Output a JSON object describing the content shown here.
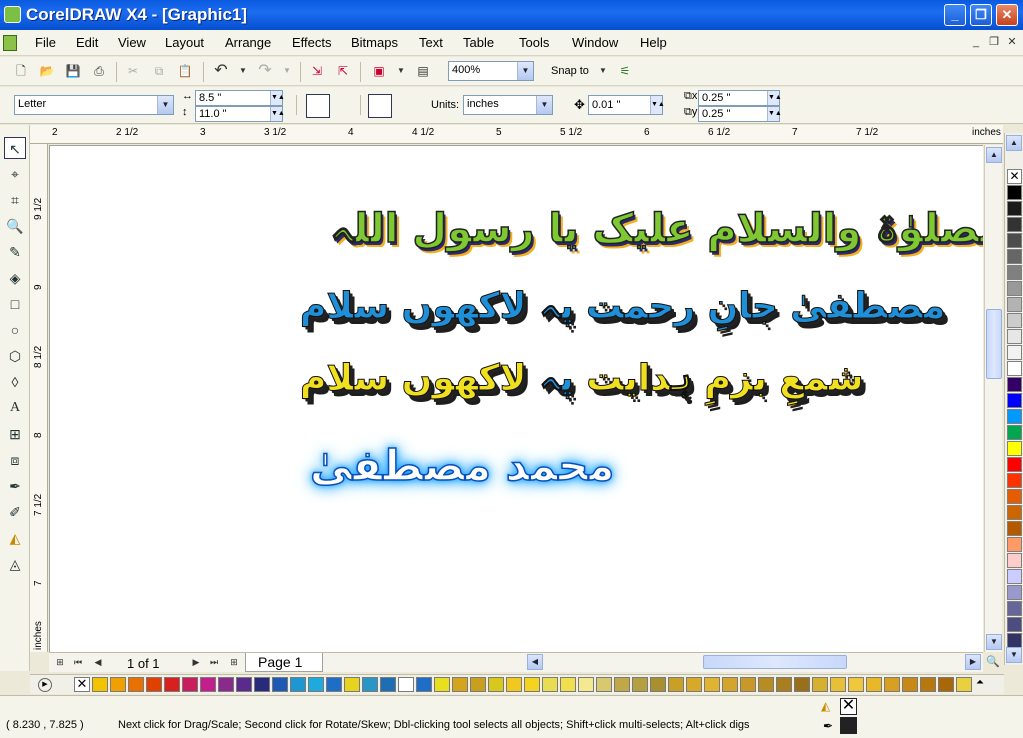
{
  "window": {
    "title": "CorelDRAW X4 - [Graphic1]"
  },
  "menu": [
    "File",
    "Edit",
    "View",
    "Layout",
    "Arrange",
    "Effects",
    "Bitmaps",
    "Text",
    "Table",
    "Tools",
    "Window",
    "Help"
  ],
  "toolbar": {
    "zoom": "400%",
    "snap_label": "Snap to"
  },
  "property_bar": {
    "paper": "Letter",
    "width": "8.5 \"",
    "height": "11.0 \"",
    "units_label": "Units:",
    "units": "inches",
    "nudge": "0.01 \"",
    "dup_x": "0.25 \"",
    "dup_y": "0.25 \""
  },
  "rulers": {
    "h_labels": [
      "2",
      "2 1/2",
      "3",
      "3 1/2",
      "4",
      "4 1/2",
      "5",
      "5 1/2",
      "6",
      "6 1/2",
      "7",
      "7 1/2",
      "inches"
    ],
    "v_labels": [
      "9 1/2",
      "9",
      "8 1/2",
      "8",
      "7 1/2",
      "7",
      "inches"
    ]
  },
  "canvas": {
    "line1": "الصلوٰۃ والسلام علیک یا رسول اللہ",
    "line2": "مصطفیٰ جانِ رحمت پہ لاکھوں سلام",
    "line3_a": "شمعِ بزمِ ہدایت",
    "line3_b": "پہ",
    "line3_c": "لاکھوں سلام",
    "line4": "محمد مصطفیٰ"
  },
  "pager": {
    "counter": "1 of 1",
    "page_tab": "Page 1"
  },
  "status": {
    "coords": "( 8.230 , 7.825  )",
    "hint": "Next click for Drag/Scale; Second click for Rotate/Skew; Dbl-clicking tool selects all objects; Shift+click multi-selects; Alt+click digs"
  },
  "colors": {
    "vertical_palette": [
      "#ffffff",
      "#000000",
      "#1a1a1a",
      "#333333",
      "#4d4d4d",
      "#666666",
      "#808080",
      "#999999",
      "#b3b3b3",
      "#cccccc",
      "#e6e6e6",
      "#f2f2f2",
      "#ffffff",
      "#330066",
      "#0000ff",
      "#0099ff",
      "#00a650",
      "#ffff00",
      "#ff0000",
      "#ff3300",
      "#e65c00",
      "#cc6600",
      "#b35900",
      "#ff9966",
      "#ffcccc",
      "#ccccff",
      "#9999cc",
      "#666699",
      "#4d4d80",
      "#333366"
    ],
    "horizontal_palette": [
      "#f4c300",
      "#f0a000",
      "#e87000",
      "#e04000",
      "#d8201e",
      "#c81e60",
      "#c21e8c",
      "#8a2a8c",
      "#5a2a8c",
      "#2a2a7c",
      "#1e5ab4",
      "#1e96d2",
      "#1eaadc",
      "#1e6ec8",
      "#e8d41e",
      "#2a96c8",
      "#1e6eb4",
      "#ffffff",
      "#1e6ec8",
      "#e8e01e",
      "#d4a41e",
      "#c8a01e",
      "#d8c81e",
      "#f0c81e",
      "#f4d41e",
      "#e8dc50",
      "#f0e050",
      "#f4e890",
      "#d8c870",
      "#c0a848",
      "#b4a040",
      "#a89030",
      "#c8a028",
      "#d8a828",
      "#e0b430",
      "#d4a42c",
      "#c89828",
      "#b88c24",
      "#a87e20",
      "#98701c",
      "#d8b030",
      "#e8c038",
      "#f0c840",
      "#e8b828",
      "#d8a020",
      "#c88818",
      "#b87810",
      "#a86808",
      "#e8d040"
    ]
  },
  "fill_indicator": {
    "fill": "none",
    "outline": "#222222"
  }
}
